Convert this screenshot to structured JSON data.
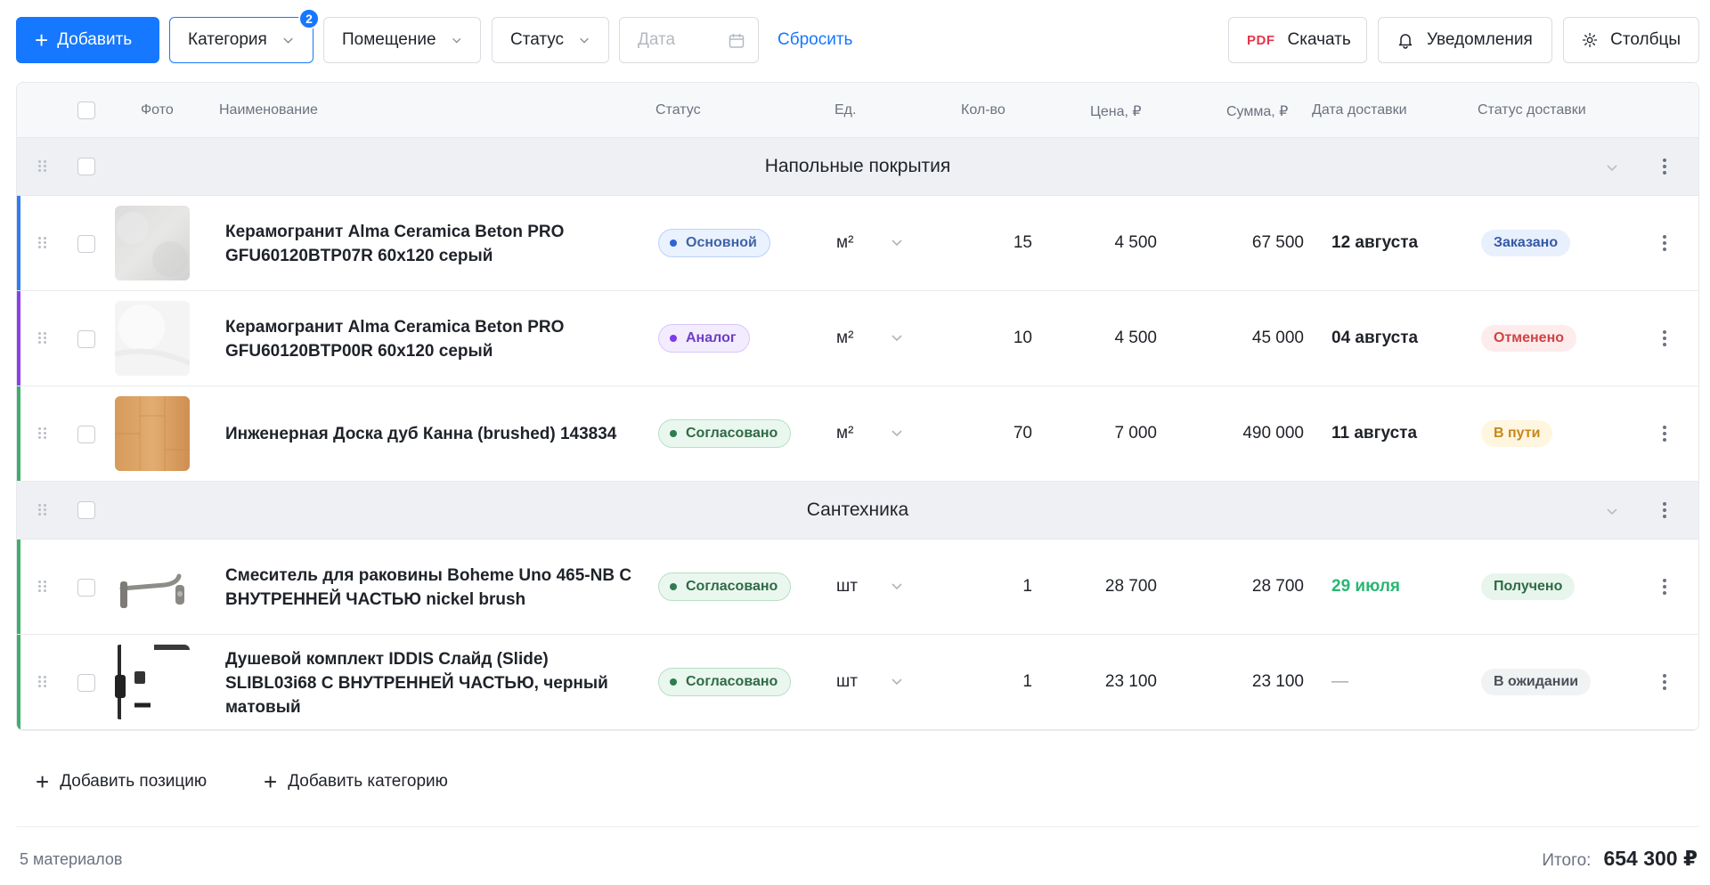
{
  "toolbar": {
    "add_label": "Добавить",
    "category_label": "Категория",
    "category_badge": "2",
    "room_label": "Помещение",
    "status_label": "Статус",
    "date_placeholder": "Дата",
    "reset_label": "Сбросить",
    "pdf_tag": "PDF",
    "download_label": "Скачать",
    "notifications_label": "Уведомления",
    "columns_label": "Столбцы"
  },
  "columns": {
    "photo": "Фото",
    "name": "Наименование",
    "status": "Статус",
    "unit": "Ед.",
    "qty": "Кол-во",
    "price": "Цена, ₽",
    "sum": "Сумма, ₽",
    "delivery_date": "Дата доставки",
    "delivery_status": "Статус доставки"
  },
  "groups": [
    {
      "title": "Напольные покрытия",
      "rows": [
        {
          "name": "Керамогранит Alma Ceramica Beton PRO GFU60120BTP07R 60x120 серый",
          "status": "Основной",
          "unit": "м²",
          "qty": "15",
          "price": "4 500",
          "sum": "67 500",
          "delivery_date": "12 августа",
          "delivery_status": "Заказано"
        },
        {
          "name": "Керамогранит Alma Ceramica Beton PRO GFU60120BTP00R 60x120 серый",
          "status": "Аналог",
          "unit": "м²",
          "qty": "10",
          "price": "4 500",
          "sum": "45 000",
          "delivery_date": "04 августа",
          "delivery_status": "Отменено"
        },
        {
          "name": "Инженерная Доска дуб Канна (brushed) 143834",
          "status": "Согласовано",
          "unit": "м²",
          "qty": "70",
          "price": "7 000",
          "sum": "490 000",
          "delivery_date": "11 августа",
          "delivery_status": "В пути"
        }
      ]
    },
    {
      "title": "Сантехника",
      "rows": [
        {
          "name": "Смеситель для раковины Boheme Uno 465-NB С ВНУТРЕННЕЙ ЧАСТЬЮ nickel brush",
          "status": "Согласовано",
          "unit": "шт",
          "qty": "1",
          "price": "28 700",
          "sum": "28 700",
          "delivery_date": "29 июля",
          "delivery_status": "Получено"
        },
        {
          "name": "Душевой комплект IDDIS Слайд (Slide) SLIBL03i68 С ВНУТРЕННЕЙ ЧАСТЬЮ, черный матовый",
          "status": "Согласовано",
          "unit": "шт",
          "qty": "1",
          "price": "23 100",
          "sum": "23 100",
          "delivery_date": "—",
          "delivery_status": "В ожидании"
        }
      ]
    }
  ],
  "actions": {
    "add_position": "Добавить позицию",
    "add_category": "Добавить категорию"
  },
  "footer": {
    "count": "5 материалов",
    "total_label": "Итого:",
    "total_value": "654 300 ₽"
  },
  "colors": {
    "accent": "#1677ff",
    "row_main": "#2f7cf6",
    "row_analog": "#8b3ef0",
    "row_ok": "#3fae6b",
    "date_ok": "#2bb673"
  }
}
